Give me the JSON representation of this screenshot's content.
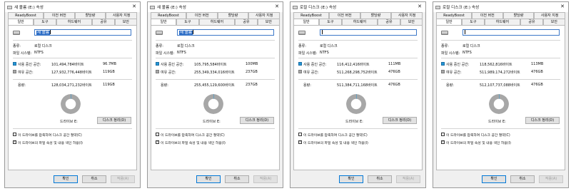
{
  "common": {
    "tabs_top": [
      "ReadyBoost",
      "이전 버전",
      "할당량",
      "사용자 지정"
    ],
    "tabs_bottom": [
      "일반",
      "도구",
      "하드웨어",
      "공유",
      "보안"
    ],
    "type_label": "종류:",
    "type_value": "로컬 디스크",
    "fs_label": "파일 시스템:",
    "fs_value": "NTFS",
    "used_label": "사용 중인 공간:",
    "free_label": "여유 공간:",
    "capacity_label": "용량:",
    "cleanup_button": "디스크 정리(D)",
    "compress_label": "이 드라이브를 압축하여 디스크 공간 절약(C)",
    "index_label": "이 드라이브의 파일 속성 및 내용 색인 허용(I)",
    "ok_button": "확인",
    "cancel_button": "취소",
    "apply_button": "적용(A)",
    "colors": {
      "used": "#2596d6",
      "free": "#a7a7a7",
      "accent": "#0078d7"
    }
  },
  "dialogs": [
    {
      "title": "새 볼륨 (E:) 속성",
      "name_value": "새 볼륨",
      "used_bytes": "101,494,784바이트",
      "used_short": "96.7MB",
      "free_bytes": "127,932,776,448바이트",
      "free_short": "119GB",
      "capacity_bytes": "128,034,271,232바이트",
      "capacity_short": "119GB",
      "drive_label": "드라이브 E:",
      "compress_checked": false,
      "index_checked": true,
      "used_fraction": 0.0008
    },
    {
      "title": "새 볼륨 (E:) 속성",
      "name_value": "새 볼륨",
      "used_bytes": "105,795,584바이트",
      "used_short": "100MB",
      "free_bytes": "255,349,334,016바이트",
      "free_short": "237GB",
      "capacity_bytes": "255,455,129,600바이트",
      "capacity_short": "237GB",
      "drive_label": "드라이브 E:",
      "compress_checked": false,
      "index_checked": true,
      "used_fraction": 0.0004
    },
    {
      "title": "로컬 디스크 (E:) 속성",
      "name_value": "",
      "used_bytes": "116,412,416바이트",
      "used_short": "111MB",
      "free_bytes": "511,268,298,752바이트",
      "free_short": "476GB",
      "capacity_bytes": "511,384,711,168바이트",
      "capacity_short": "476GB",
      "drive_label": "드라이브 E:",
      "compress_checked": false,
      "index_checked": true,
      "used_fraction": 0.0002
    },
    {
      "title": "로컬 디스크 (E:) 속성",
      "name_value": "",
      "used_bytes": "118,562,816바이트",
      "used_short": "113MB",
      "free_bytes": "511,989,174,272바이트",
      "free_short": "476GB",
      "capacity_bytes": "512,107,737,088바이트",
      "capacity_short": "476GB",
      "drive_label": "드라이브 E:",
      "compress_checked": false,
      "index_checked": true,
      "used_fraction": 0.0002
    }
  ]
}
